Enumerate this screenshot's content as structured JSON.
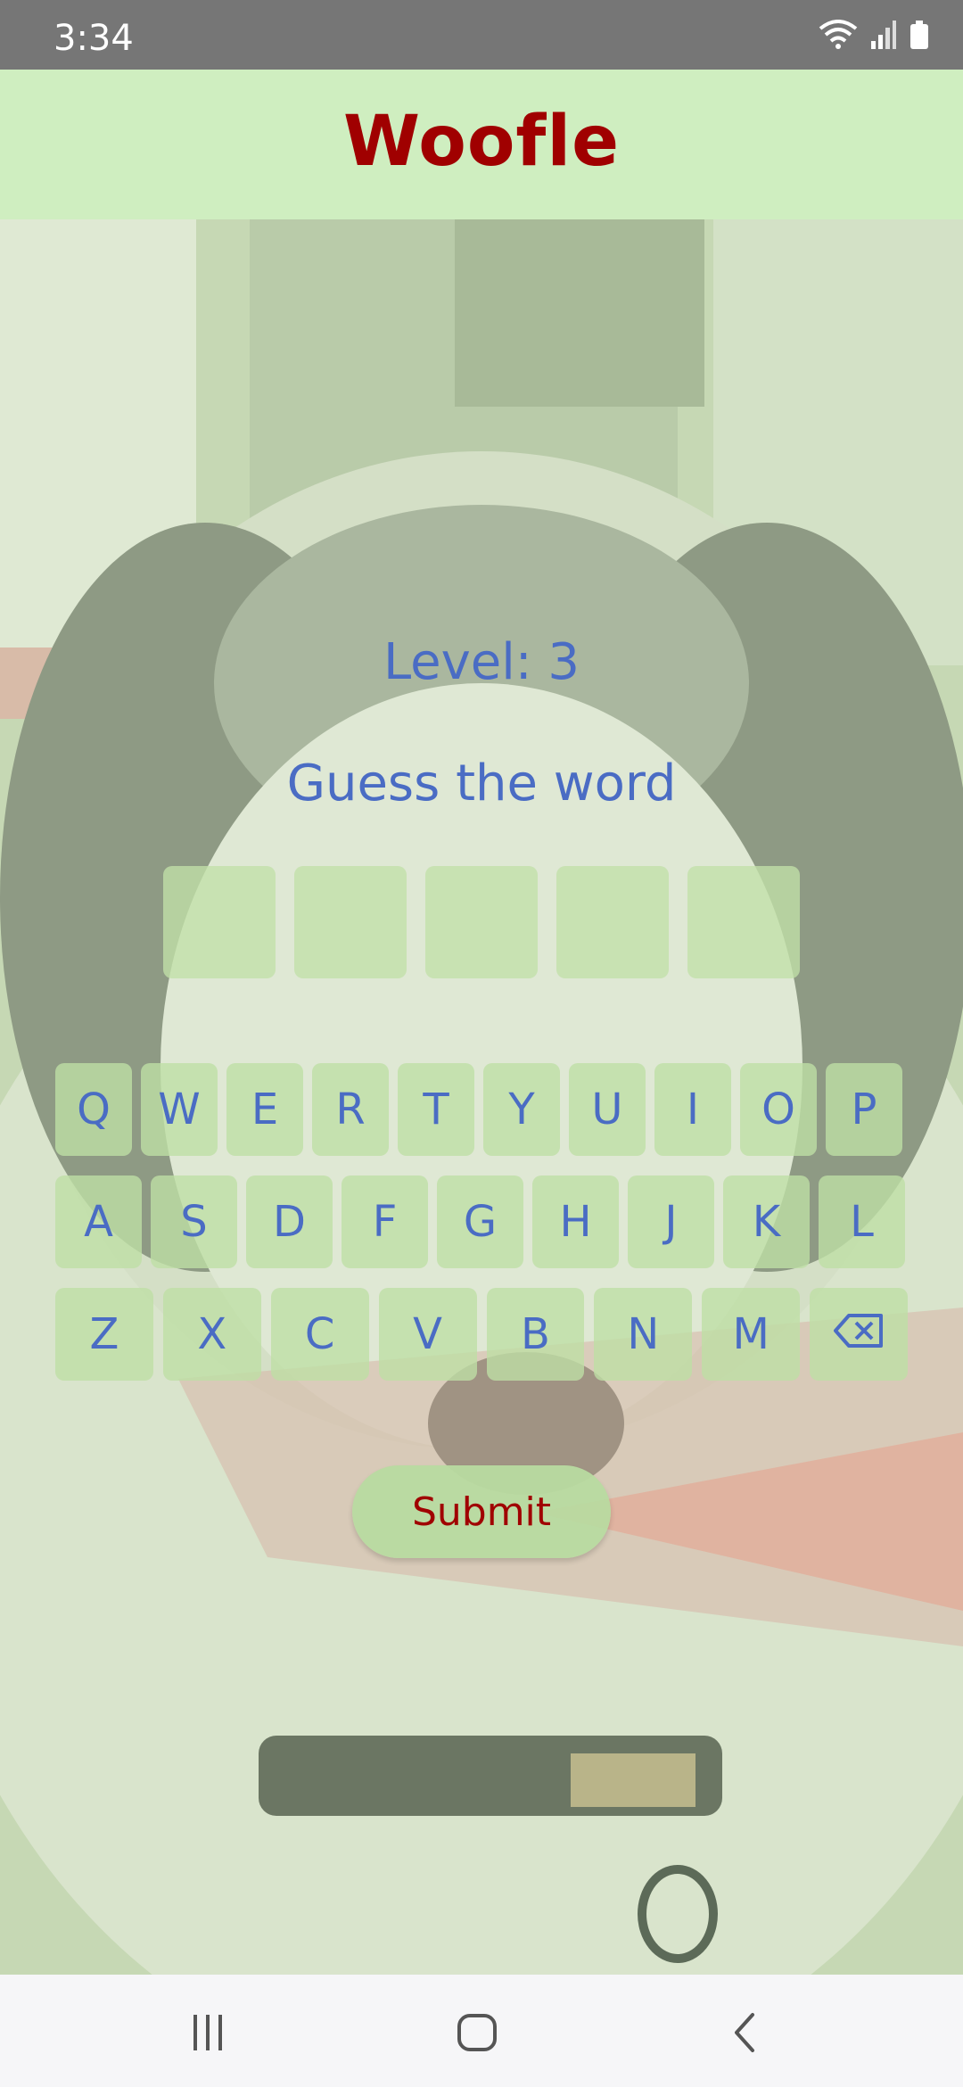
{
  "status_bar": {
    "time": "3:34",
    "icons": [
      "wifi-icon",
      "signal-icon",
      "battery-icon"
    ]
  },
  "app": {
    "title": "Woofle",
    "title_color": "#a00000",
    "accent_color": "#4a6cc4"
  },
  "game": {
    "level_text": "Level: 3",
    "prompt": "Guess the word",
    "tiles": [
      "",
      "",
      "",
      "",
      ""
    ]
  },
  "keyboard": {
    "row1": [
      "Q",
      "W",
      "E",
      "R",
      "T",
      "Y",
      "U",
      "I",
      "O",
      "P"
    ],
    "row2": [
      "A",
      "S",
      "D",
      "F",
      "G",
      "H",
      "J",
      "K",
      "L"
    ],
    "row3": [
      "Z",
      "X",
      "C",
      "V",
      "B",
      "N",
      "M"
    ],
    "backspace_icon": "backspace-icon"
  },
  "submit_label": "Submit",
  "nav_bar": {
    "buttons": [
      "recents-icon",
      "home-icon",
      "back-icon"
    ]
  }
}
